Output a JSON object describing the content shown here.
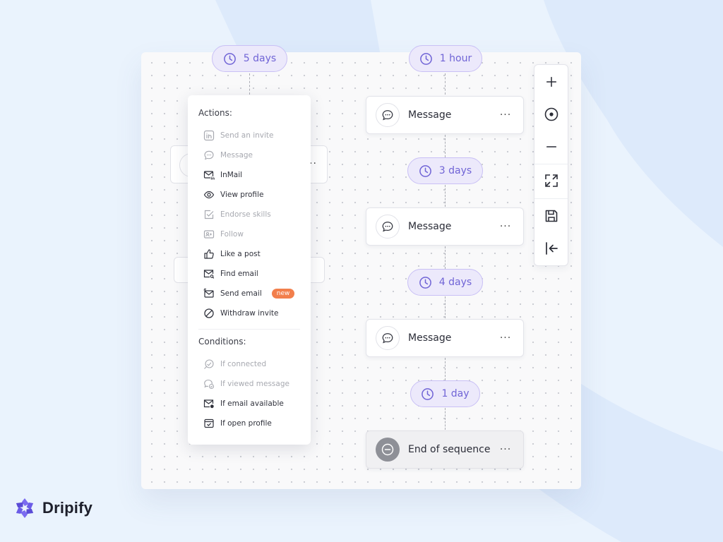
{
  "brand": {
    "name": "Dripify",
    "color": "#6b5ce7"
  },
  "delays": {
    "top_left": "5 days",
    "top_right": "1 hour",
    "second": "3 days",
    "third": "4 days",
    "fourth": "1 day"
  },
  "sequence": {
    "step1": "Message",
    "step2": "Message",
    "step3": "Message",
    "end": "End of sequence",
    "more": "···"
  },
  "menu": {
    "actions_heading": "Actions:",
    "actions": [
      {
        "label": "Send an invite",
        "icon": "linkedin-icon",
        "enabled": false
      },
      {
        "label": "Message",
        "icon": "chat-bubble-icon",
        "enabled": false
      },
      {
        "label": "InMail",
        "icon": "inmail-icon",
        "enabled": true
      },
      {
        "label": "View profile",
        "icon": "eye-icon",
        "enabled": true
      },
      {
        "label": "Endorse skills",
        "icon": "check-square-icon",
        "enabled": false
      },
      {
        "label": "Follow",
        "icon": "follow-icon",
        "enabled": false
      },
      {
        "label": "Like a post",
        "icon": "thumbs-up-icon",
        "enabled": true
      },
      {
        "label": "Find email",
        "icon": "find-email-icon",
        "enabled": true
      },
      {
        "label": "Send email",
        "icon": "send-email-icon",
        "enabled": true,
        "badge": "new"
      },
      {
        "label": "Withdraw invite",
        "icon": "ban-icon",
        "enabled": true
      }
    ],
    "conditions_heading": "Conditions:",
    "conditions": [
      {
        "label": "If connected",
        "icon": "connected-icon",
        "enabled": false
      },
      {
        "label": "If viewed message",
        "icon": "viewed-message-icon",
        "enabled": false
      },
      {
        "label": "If email available",
        "icon": "email-available-icon",
        "enabled": true
      },
      {
        "label": "If open profile",
        "icon": "open-profile-icon",
        "enabled": true
      }
    ]
  },
  "toolbar": [
    "zoom-in-icon",
    "center-icon",
    "zoom-out-icon",
    "fit-screen-icon",
    "save-icon",
    "exit-icon"
  ],
  "colors": {
    "pill_bg": "#ece9fb",
    "pill_text": "#7064d6",
    "badge": "#f27f4c",
    "background": "#eaf3fd"
  }
}
